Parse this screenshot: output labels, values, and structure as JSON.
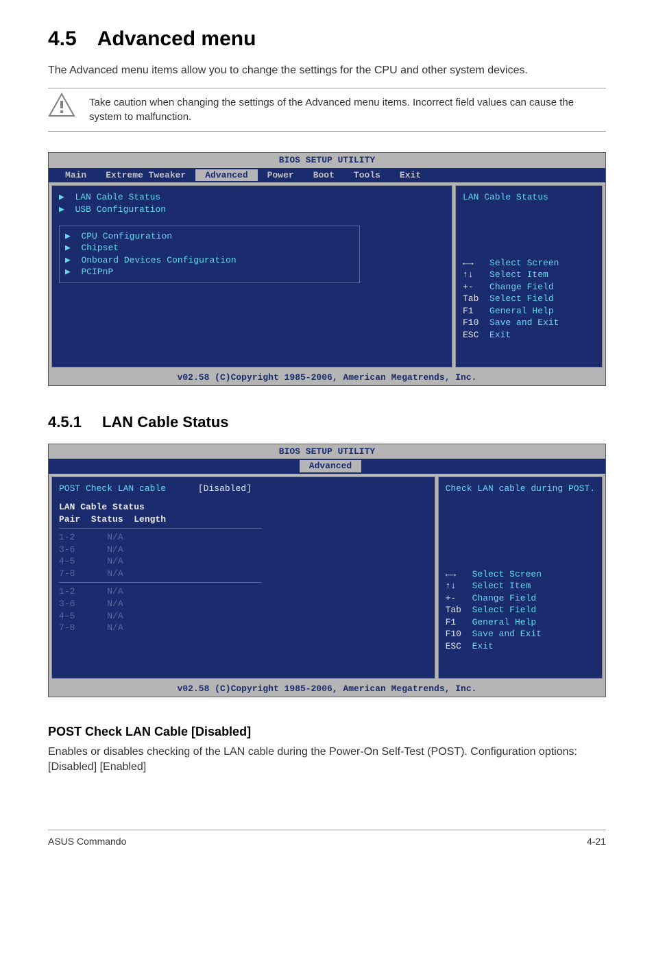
{
  "section": {
    "number": "4.5",
    "title": "Advanced menu"
  },
  "intro": "The Advanced menu items allow you to change the settings for the CPU and other system devices.",
  "caution": "Take caution when changing the settings of the Advanced menu items. Incorrect field values can cause the system to malfunction.",
  "bios1": {
    "title": "BIOS SETUP UTILITY",
    "tabs": [
      "Main",
      "Extreme Tweaker",
      "Advanced",
      "Power",
      "Boot",
      "Tools",
      "Exit"
    ],
    "active_tab": "Advanced",
    "top_items": [
      "LAN Cable Status",
      "USB Configuration"
    ],
    "group_items": [
      "CPU Configuration",
      "Chipset",
      "Onboard Devices Configuration",
      "PCIPnP"
    ],
    "right_help": "LAN Cable Status",
    "legend": [
      {
        "key": "←→",
        "label": "Select Screen"
      },
      {
        "key": "↑↓",
        "label": "Select Item"
      },
      {
        "key": "+-",
        "label": "Change Field"
      },
      {
        "key": "Tab",
        "label": "Select Field"
      },
      {
        "key": "F1",
        "label": "General Help"
      },
      {
        "key": "F10",
        "label": "Save and Exit"
      },
      {
        "key": "ESC",
        "label": "Exit"
      }
    ],
    "footer": "v02.58 (C)Copyright 1985-2006, American Megatrends, Inc."
  },
  "subsection": {
    "number": "4.5.1",
    "title": "LAN Cable Status"
  },
  "bios2": {
    "title": "BIOS SETUP UTILITY",
    "active_tab": "Advanced",
    "field_label": "POST Check LAN cable",
    "field_value": "[Disabled]",
    "table_title": "LAN Cable Status",
    "columns": "Pair  Status  Length",
    "rows_a": [
      {
        "pair": "1-2",
        "status": "N/A"
      },
      {
        "pair": "3-6",
        "status": "N/A"
      },
      {
        "pair": "4-5",
        "status": "N/A"
      },
      {
        "pair": "7-8",
        "status": "N/A"
      }
    ],
    "rows_b": [
      {
        "pair": "1-2",
        "status": "N/A"
      },
      {
        "pair": "3-6",
        "status": "N/A"
      },
      {
        "pair": "4-5",
        "status": "N/A"
      },
      {
        "pair": "7-8",
        "status": "N/A"
      }
    ],
    "right_help": "Check LAN cable during POST.",
    "legend": [
      {
        "key": "←→",
        "label": "Select Screen"
      },
      {
        "key": "↑↓",
        "label": "Select Item"
      },
      {
        "key": "+-",
        "label": "Change Field"
      },
      {
        "key": "Tab",
        "label": "Select Field"
      },
      {
        "key": "F1",
        "label": "General Help"
      },
      {
        "key": "F10",
        "label": "Save and Exit"
      },
      {
        "key": "ESC",
        "label": "Exit"
      }
    ],
    "footer": "v02.58 (C)Copyright 1985-2006, American Megatrends, Inc."
  },
  "field_heading": "POST Check LAN Cable  [Disabled]",
  "field_desc": "Enables or disables checking of the LAN cable during the Power-On Self-Test (POST). Configuration options: [Disabled] [Enabled]",
  "footer_left": "ASUS Commando",
  "footer_right": "4-21"
}
